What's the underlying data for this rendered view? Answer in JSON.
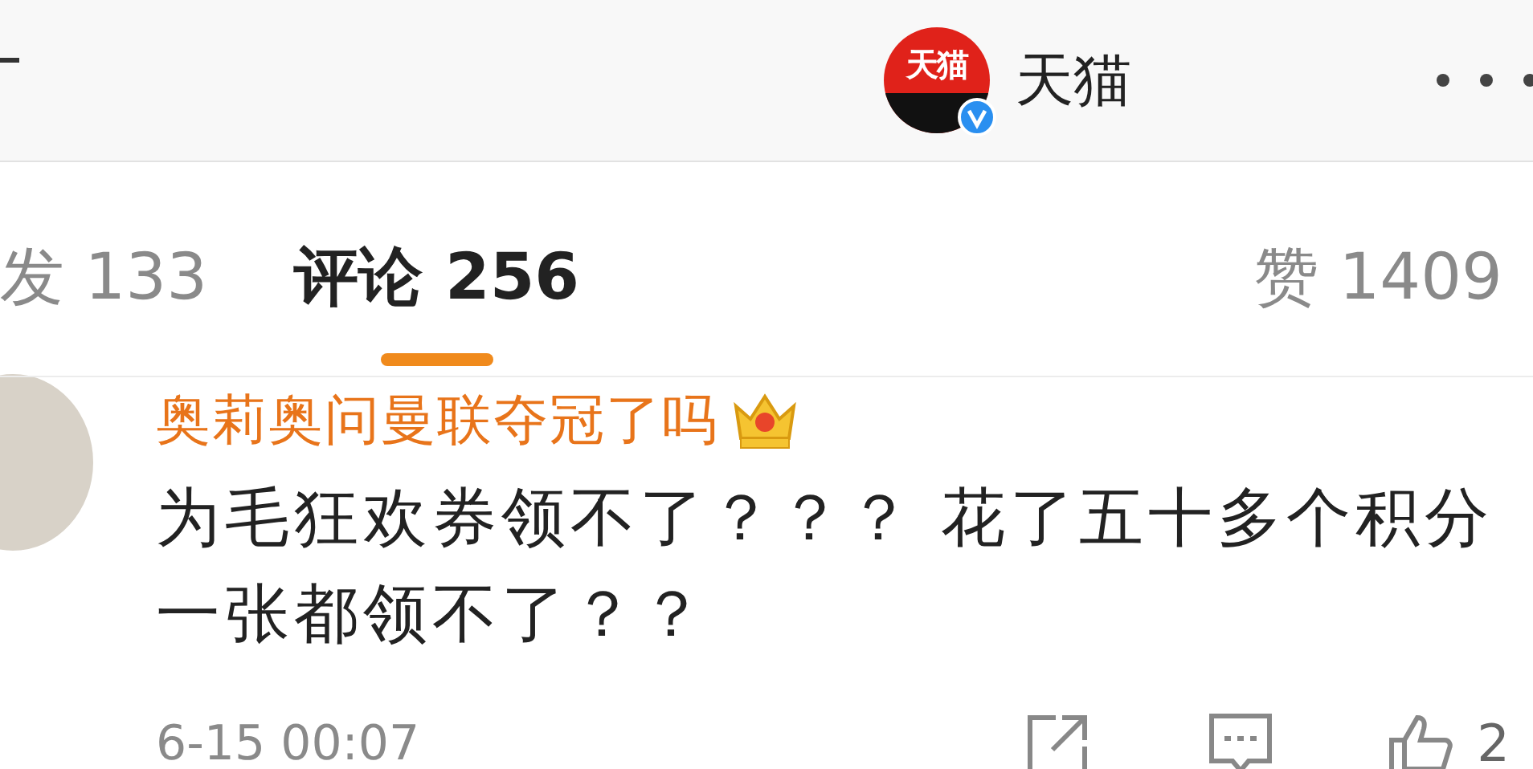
{
  "header": {
    "title": "天猫",
    "logo_text": "天猫",
    "verified": true
  },
  "tabs": [
    {
      "label": "发 133",
      "selected": false
    },
    {
      "label": "评论 256",
      "selected": true
    },
    {
      "label": "赞 1409",
      "selected": false
    }
  ],
  "comment": {
    "author": "奥莉奥问曼联夺冠了吗",
    "body": "为毛狂欢券领不了？？？ 花了五十多个积分一张都领不了？？",
    "time": "6-15 00:07",
    "like_count": "2"
  }
}
